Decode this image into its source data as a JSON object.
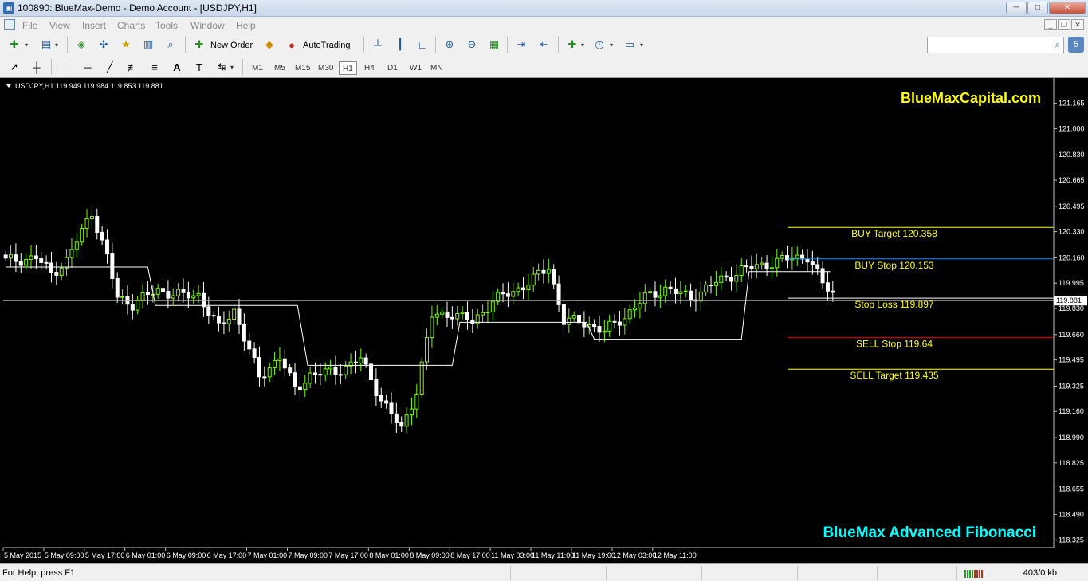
{
  "window": {
    "title": "100890: BlueMax-Demo - Demo Account - [USDJPY,H1]",
    "minimize": "─",
    "maximize": "□",
    "close": "✕"
  },
  "menu": {
    "items": [
      "File",
      "View",
      "Insert",
      "Charts",
      "Tools",
      "Window",
      "Help"
    ]
  },
  "toolbar": {
    "new_order_label": "New Order",
    "autotrading_label": "AutoTrading",
    "timeframes": [
      "M1",
      "M5",
      "M15",
      "M30",
      "H1",
      "H4",
      "D1",
      "W1",
      "MN"
    ],
    "active_timeframe": "H1"
  },
  "search": {
    "placeholder": ""
  },
  "chart": {
    "symbol_info": "USDJPY,H1  119.949 119.984 119.853 119.881",
    "brand_top": "BlueMaxCapital.com",
    "brand_bottom": "BlueMax Advanced Fibonacci",
    "current_price": "119.881",
    "colors": {
      "background": "#000000",
      "bull": "#7cfc00",
      "bear": "#ffffff",
      "brand_top": "#ffff00",
      "brand_bottom": "#00ffff",
      "buy_target": "#ffff00",
      "buy_stop": "#1e90ff",
      "stop_loss": "#ffffff",
      "sell_stop": "#ff0000",
      "sell_target": "#ffff00"
    },
    "levels": [
      {
        "label": "BUY Target  120.358",
        "price": 120.358,
        "key": "buy_target"
      },
      {
        "label": "BUY Stop    120.153",
        "price": 120.153,
        "key": "buy_stop"
      },
      {
        "label": "Stop Loss   119.897",
        "price": 119.897,
        "key": "stop_loss"
      },
      {
        "label": "SELL Stop   119.64",
        "price": 119.64,
        "key": "sell_stop"
      },
      {
        "label": "SELL Target 119.435",
        "price": 119.435,
        "key": "sell_target"
      }
    ]
  },
  "chart_data": {
    "type": "candlestick",
    "symbol": "USDJPY",
    "timeframe": "H1",
    "ylim": [
      118.29,
      121.215
    ],
    "y_ticks": [
      "121.165",
      "121.000",
      "120.830",
      "120.665",
      "120.495",
      "120.330",
      "120.160",
      "119.995",
      "119.830",
      "119.660",
      "119.495",
      "119.325",
      "119.160",
      "118.990",
      "118.825",
      "118.655",
      "118.490",
      "118.325"
    ],
    "x_ticks": [
      "5 May 2015",
      "5 May 09:00",
      "5 May 17:00",
      "6 May 01:00",
      "6 May 09:00",
      "6 May 17:00",
      "7 May 01:00",
      "7 May 09:00",
      "7 May 17:00",
      "8 May 01:00",
      "8 May 09:00",
      "8 May 17:00",
      "11 May 03:00",
      "11 May 11:00",
      "11 May 19:00",
      "12 May 03:00",
      "12 May 11:00"
    ],
    "close_anchors": [
      [
        0,
        120.14
      ],
      [
        6,
        120.16
      ],
      [
        9,
        120.06
      ],
      [
        12,
        120.14
      ],
      [
        17,
        120.46
      ],
      [
        20,
        120.16
      ],
      [
        22,
        119.9
      ],
      [
        25,
        119.86
      ],
      [
        30,
        119.95
      ],
      [
        35,
        119.91
      ],
      [
        38,
        119.92
      ],
      [
        42,
        119.7
      ],
      [
        45,
        119.82
      ],
      [
        50,
        119.38
      ],
      [
        54,
        119.52
      ],
      [
        57,
        119.3
      ],
      [
        60,
        119.4
      ],
      [
        65,
        119.42
      ],
      [
        70,
        119.5
      ],
      [
        74,
        119.24
      ],
      [
        78,
        119.04
      ],
      [
        81,
        119.3
      ],
      [
        84,
        119.78
      ],
      [
        88,
        119.8
      ],
      [
        92,
        119.74
      ],
      [
        96,
        119.88
      ],
      [
        100,
        119.94
      ],
      [
        104,
        120.02
      ],
      [
        107,
        120.1
      ],
      [
        110,
        119.75
      ],
      [
        114,
        119.74
      ],
      [
        118,
        119.68
      ],
      [
        122,
        119.78
      ],
      [
        126,
        119.9
      ],
      [
        130,
        119.96
      ],
      [
        135,
        119.9
      ],
      [
        140,
        120.0
      ],
      [
        145,
        120.08
      ],
      [
        150,
        120.12
      ],
      [
        155,
        120.16
      ],
      [
        158,
        120.17
      ],
      [
        161,
        119.99
      ],
      [
        163,
        119.93
      ]
    ],
    "overlay_line": [
      [
        0,
        120.1
      ],
      [
        28,
        120.1
      ],
      [
        29.5,
        119.85
      ],
      [
        57.5,
        119.85
      ],
      [
        59.5,
        119.46
      ],
      [
        88,
        119.46
      ],
      [
        89.5,
        119.74
      ],
      [
        114.5,
        119.74
      ],
      [
        116,
        119.63
      ],
      [
        145,
        119.63
      ],
      [
        146.5,
        120.07
      ],
      [
        162.5,
        120.07
      ]
    ],
    "overlay_color": "#ffffff"
  },
  "status": {
    "help_text": "For Help, press F1",
    "traffic": "403/0 kb"
  }
}
